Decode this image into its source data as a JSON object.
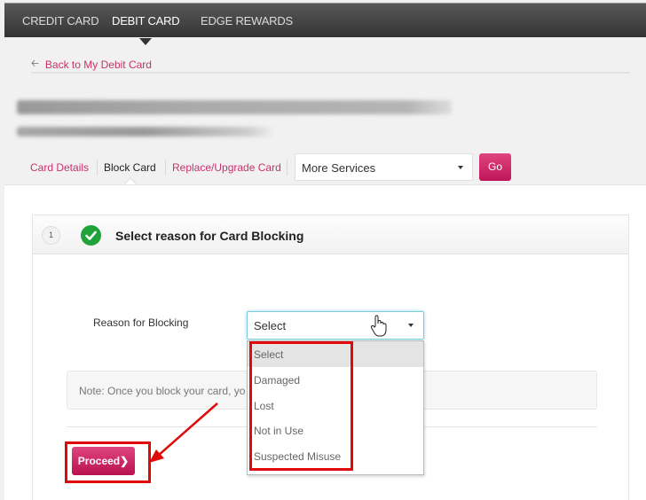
{
  "topnav": {
    "tabs": [
      {
        "label": "CREDIT CARD",
        "active": false
      },
      {
        "label": "DEBIT CARD",
        "active": true
      },
      {
        "label": "EDGE REWARDS",
        "active": false
      }
    ]
  },
  "back_link": {
    "label": "Back to My Debit Card",
    "icon": "arrow-left-icon"
  },
  "subtabs": [
    {
      "label": "Card Details",
      "active": false
    },
    {
      "label": "Block Card",
      "active": true
    },
    {
      "label": "Replace/Upgrade Card",
      "active": false
    }
  ],
  "services": {
    "selected": "More Services",
    "go_label": "Go"
  },
  "panel": {
    "step_number": "1",
    "status_icon": "check-circle-icon",
    "title": "Select reason for Card Blocking"
  },
  "form": {
    "reason_label": "Reason for Blocking",
    "reason_selected": "Select",
    "options": [
      "Select",
      "Damaged",
      "Lost",
      "Not in Use",
      "Suspected Misuse"
    ],
    "highlighted_option": "Select"
  },
  "note": {
    "text": "Note: Once you block your card, yo"
  },
  "actions": {
    "proceed_label": "Proceed",
    "proceed_icon": "chevron-right-icon"
  },
  "colors": {
    "brand_pink": "#c8326b",
    "button_pink": "#c0145a",
    "annotation_red": "#e00a0a",
    "success_green": "#1fa23a",
    "nav_dark": "#343434",
    "focus_blue": "#7ccbd8"
  }
}
